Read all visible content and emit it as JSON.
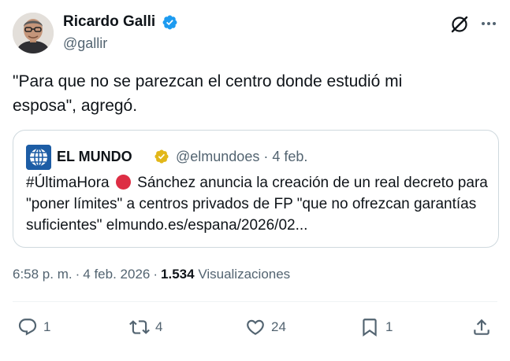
{
  "author": {
    "name": "Ricardo Galli",
    "handle": "@gallir",
    "verified": true
  },
  "tweet": {
    "text": "\"Para que no se parezcan el centro donde estudió mi\nesposa\", agregó."
  },
  "quote": {
    "name": "EL MUNDO",
    "handle": "@elmundoes",
    "separator": "·",
    "date": "4 feb.",
    "text_before": "#ÚltimaHora",
    "text_after": "Sánchez anuncia la creación de un real decreto para \"poner límites\" a centros privados de FP \"que no ofrezcan garantías suficientes\" elmundo.es/espana/2026/02..."
  },
  "meta": {
    "time": "6:58 p. m.",
    "sep": "·",
    "date": "4 feb. 2026",
    "sep2": "·",
    "views_count": "1.534",
    "views_label": "Visualizaciones"
  },
  "actions": {
    "replies": "1",
    "retweets": "4",
    "likes": "24",
    "bookmarks": "1"
  },
  "colors": {
    "verified_blue": "#1d9bf0",
    "gold_badge": "#e2b719",
    "muted_text": "#536471",
    "red_dot": "#dd2e44"
  },
  "icons": [
    "verified-badge-icon",
    "grok-icon",
    "more-icon",
    "gold-verified-icon",
    "reply-icon",
    "retweet-icon",
    "like-icon",
    "bookmark-icon",
    "share-icon"
  ]
}
